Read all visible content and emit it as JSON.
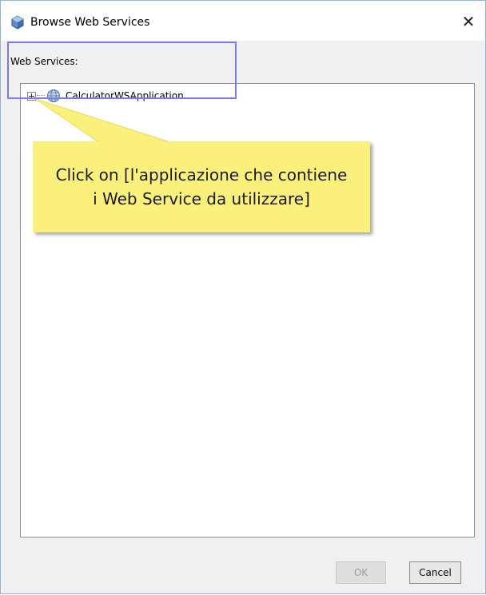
{
  "window": {
    "title": "Browse Web Services",
    "close_glyph": "✕"
  },
  "section": {
    "label": "Web Services:"
  },
  "tree": {
    "items": [
      {
        "label": "CalculatorWSApplication",
        "icon": "globe-icon",
        "expanded": false
      }
    ]
  },
  "callout": {
    "text": "Click on [l'applicazione che contiene\ni Web Service da utilizzare]"
  },
  "buttons": {
    "ok_label": "OK",
    "cancel_label": "Cancel"
  },
  "colors": {
    "highlight_border": "#7b7bf0",
    "callout_background": "#fbf07c",
    "ok_disabled_text": "#9a9a9a"
  }
}
